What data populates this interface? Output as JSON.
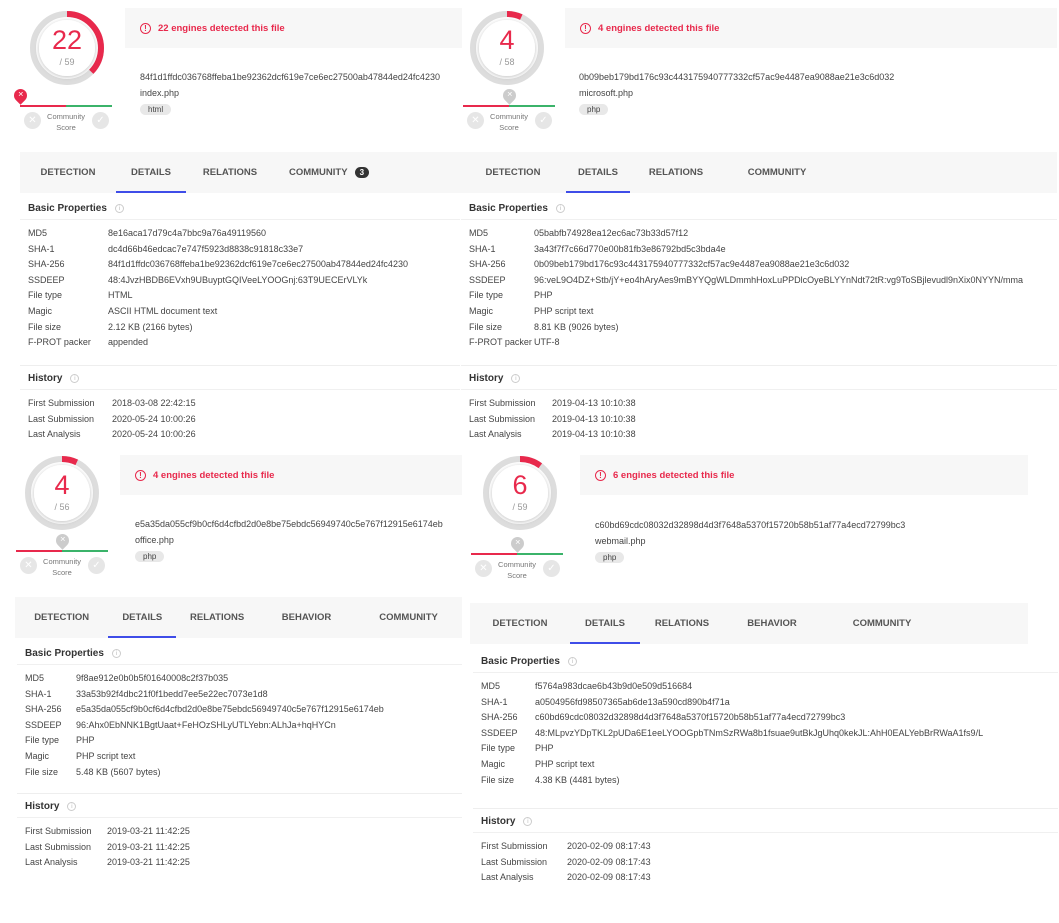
{
  "colors": {
    "accent": "#e8294c",
    "tab_active": "#3f4de8",
    "positive": "#3bb36a"
  },
  "community_label": "Community Score",
  "section_titles": {
    "basic": "Basic Properties",
    "history": "History"
  },
  "panels": [
    {
      "detected": 22,
      "total": 59,
      "total_label": "/ 59",
      "header": "22 engines detected this file",
      "hash": "84f1d1ffdc036768ffeba1be92362dcf619e7ce6ec27500ab47844ed24fc4230",
      "filename": "index.php",
      "tag": "html",
      "community_marked": true,
      "tabs": [
        {
          "label": "DETECTION"
        },
        {
          "label": "DETAILS",
          "active": true
        },
        {
          "label": "RELATIONS"
        },
        {
          "label": "COMMUNITY",
          "badge": "3"
        }
      ],
      "properties": [
        [
          "MD5",
          "8e16aca17d79c4a7bbc9a76a49119560"
        ],
        [
          "SHA-1",
          "dc4d66b46edcac7e747f5923d8838c91818c33e7"
        ],
        [
          "SHA-256",
          "84f1d1ffdc036768ffeba1be92362dcf619e7ce6ec27500ab47844ed24fc4230"
        ],
        [
          "SSDEEP",
          "48:4JvzHBDB6EVxh9UBuyptGQIVeeLYOOGnj:63T9UECErVLYk"
        ],
        [
          "File type",
          "HTML"
        ],
        [
          "Magic",
          "ASCII HTML document text"
        ],
        [
          "File size",
          "2.12 KB (2166 bytes)"
        ],
        [
          "F-PROT packer",
          "appended"
        ]
      ],
      "history": [
        [
          "First Submission",
          "2018-03-08 22:42:15"
        ],
        [
          "Last Submission",
          "2020-05-24 10:00:26"
        ],
        [
          "Last Analysis",
          "2020-05-24 10:00:26"
        ]
      ]
    },
    {
      "detected": 4,
      "total": 58,
      "total_label": "/ 58",
      "header": "4 engines detected this file",
      "hash": "0b09beb179bd176c93c443175940777332cf57ac9e4487ea9088ae21e3c6d032",
      "filename": "microsoft.php",
      "tag": "php",
      "community_marked": false,
      "tabs": [
        {
          "label": "DETECTION"
        },
        {
          "label": "DETAILS",
          "active": true
        },
        {
          "label": "RELATIONS"
        },
        {
          "label": "COMMUNITY"
        }
      ],
      "properties": [
        [
          "MD5",
          "05babfb74928ea12ec6ac73b33d57f12"
        ],
        [
          "SHA-1",
          "3a43f7f7c66d770e00b81fb3e86792bd5c3bda4e"
        ],
        [
          "SHA-256",
          "0b09beb179bd176c93c443175940777332cf57ac9e4487ea9088ae21e3c6d032"
        ],
        [
          "SSDEEP",
          "96:veL9O4DZ+Stb/jY+eo4hAryAes9mBYYQgWLDmmhHoxLuPPDlcOyeBLYYnNdt72tR:vg9ToSBjlevudl9nXix0NYYN/mma"
        ],
        [
          "File type",
          "PHP"
        ],
        [
          "Magic",
          "PHP script text"
        ],
        [
          "File size",
          "8.81 KB (9026 bytes)"
        ],
        [
          "F-PROT packer",
          "UTF-8"
        ]
      ],
      "history": [
        [
          "First Submission",
          "2019-04-13 10:10:38"
        ],
        [
          "Last Submission",
          "2019-04-13 10:10:38"
        ],
        [
          "Last Analysis",
          "2019-04-13 10:10:38"
        ]
      ]
    },
    {
      "detected": 4,
      "total": 56,
      "total_label": "/ 56",
      "header": "4 engines detected this file",
      "hash": "e5a35da055cf9b0cf6d4cfbd2d0e8be75ebdc56949740c5e767f12915e6174eb",
      "filename": "office.php",
      "tag": "php",
      "community_marked": false,
      "tabs": [
        {
          "label": "DETECTION"
        },
        {
          "label": "DETAILS",
          "active": true
        },
        {
          "label": "RELATIONS"
        },
        {
          "label": "BEHAVIOR"
        },
        {
          "label": "COMMUNITY"
        }
      ],
      "properties": [
        [
          "MD5",
          "9f8ae912e0b0b5f01640008c2f37b035"
        ],
        [
          "SHA-1",
          "33a53b92f4dbc21f0f1bedd7ee5e22ec7073e1d8"
        ],
        [
          "SHA-256",
          "e5a35da055cf9b0cf6d4cfbd2d0e8be75ebdc56949740c5e767f12915e6174eb"
        ],
        [
          "SSDEEP",
          "96:Ahx0EbNNK1BgtUaat+FeHOzSHLyUTLYebn:ALhJa+hqHYCn"
        ],
        [
          "File type",
          "PHP"
        ],
        [
          "Magic",
          "PHP script text"
        ],
        [
          "File size",
          "5.48 KB (5607 bytes)"
        ]
      ],
      "history": [
        [
          "First Submission",
          "2019-03-21 11:42:25"
        ],
        [
          "Last Submission",
          "2019-03-21 11:42:25"
        ],
        [
          "Last Analysis",
          "2019-03-21 11:42:25"
        ]
      ]
    },
    {
      "detected": 6,
      "total": 59,
      "total_label": "/ 59",
      "header": "6 engines detected this file",
      "hash": "c60bd69cdc08032d32898d4d3f7648a5370f15720b58b51af77a4ecd72799bc3",
      "filename": "webmail.php",
      "tag": "php",
      "community_marked": false,
      "tabs": [
        {
          "label": "DETECTION"
        },
        {
          "label": "DETAILS",
          "active": true
        },
        {
          "label": "RELATIONS"
        },
        {
          "label": "BEHAVIOR"
        },
        {
          "label": "COMMUNITY"
        }
      ],
      "properties": [
        [
          "MD5",
          "f5764a983dcae6b43b9d0e509d516684"
        ],
        [
          "SHA-1",
          "a0504956fd98507365ab6de13a590cd890b4f71a"
        ],
        [
          "SHA-256",
          "c60bd69cdc08032d32898d4d3f7648a5370f15720b58b51af77a4ecd72799bc3"
        ],
        [
          "SSDEEP",
          "48:MLpvzYDpTKL2pUDa6E1eeLYOOGpbTNmSzRWa8b1fsuae9utBkJgUhq0kekJL:AhH0EALYebBrRWaA1fs9/L"
        ],
        [
          "File type",
          "PHP"
        ],
        [
          "Magic",
          "PHP script text"
        ],
        [
          "File size",
          "4.38 KB (4481 bytes)"
        ]
      ],
      "history": [
        [
          "First Submission",
          "2020-02-09 08:17:43"
        ],
        [
          "Last Submission",
          "2020-02-09 08:17:43"
        ],
        [
          "Last Analysis",
          "2020-02-09 08:17:43"
        ]
      ]
    }
  ]
}
